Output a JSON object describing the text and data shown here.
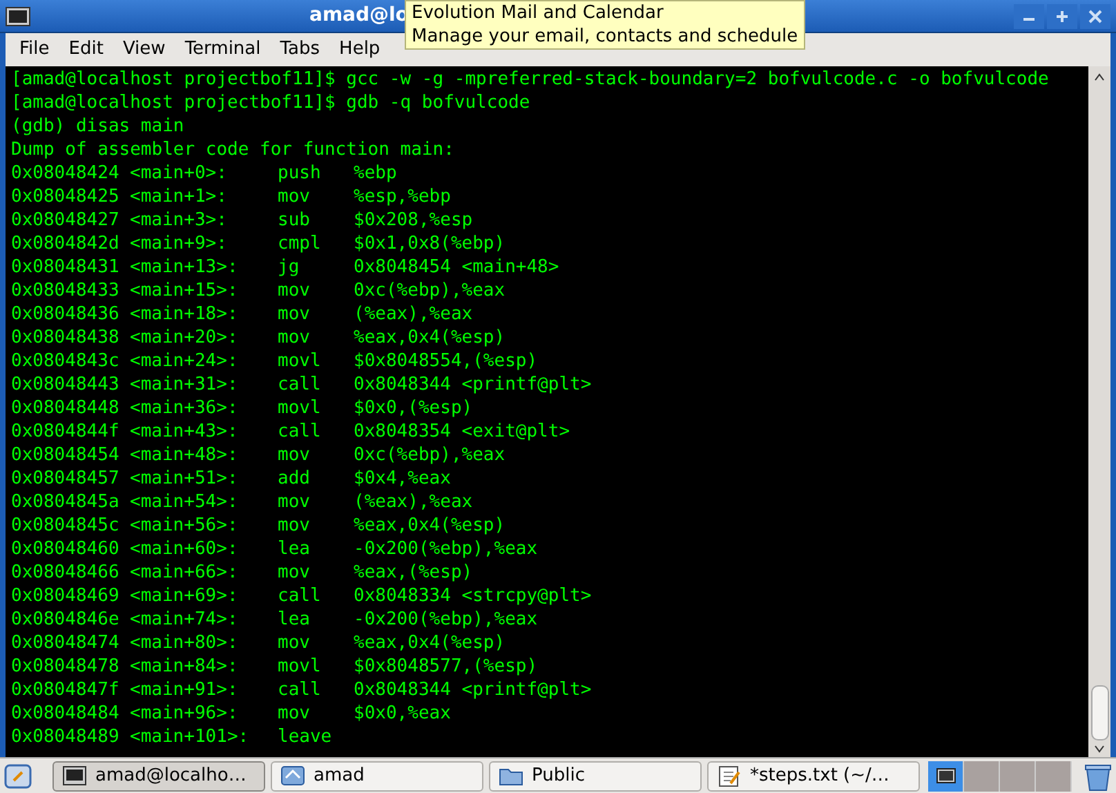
{
  "window": {
    "title": "amad@lo"
  },
  "tooltip": {
    "lines": [
      "Evolution Mail and Calendar",
      "Manage your email, contacts and schedule"
    ]
  },
  "menu": [
    "File",
    "Edit",
    "View",
    "Terminal",
    "Tabs",
    "Help"
  ],
  "terminal": [
    {
      "kind": "text",
      "text": "[amad@localhost projectbof11]$ gcc -w -g -mpreferred-stack-boundary=2 bofvulcode.c -o bofvulcode"
    },
    {
      "kind": "text",
      "text": "[amad@localhost projectbof11]$ gdb -q bofvulcode"
    },
    {
      "kind": "text",
      "text": "(gdb) disas main"
    },
    {
      "kind": "text",
      "text": "Dump of assembler code for function main:"
    },
    {
      "kind": "asm",
      "address": "0x08048424",
      "offset": "<main+0>:",
      "op": "push",
      "args": "%ebp"
    },
    {
      "kind": "asm",
      "address": "0x08048425",
      "offset": "<main+1>:",
      "op": "mov",
      "args": "%esp,%ebp"
    },
    {
      "kind": "asm",
      "address": "0x08048427",
      "offset": "<main+3>:",
      "op": "sub",
      "args": "$0x208,%esp"
    },
    {
      "kind": "asm",
      "address": "0x0804842d",
      "offset": "<main+9>:",
      "op": "cmpl",
      "args": "$0x1,0x8(%ebp)"
    },
    {
      "kind": "asm",
      "address": "0x08048431",
      "offset": "<main+13>:",
      "op": "jg",
      "args": "0x8048454 <main+48>"
    },
    {
      "kind": "asm",
      "address": "0x08048433",
      "offset": "<main+15>:",
      "op": "mov",
      "args": "0xc(%ebp),%eax"
    },
    {
      "kind": "asm",
      "address": "0x08048436",
      "offset": "<main+18>:",
      "op": "mov",
      "args": "(%eax),%eax"
    },
    {
      "kind": "asm",
      "address": "0x08048438",
      "offset": "<main+20>:",
      "op": "mov",
      "args": "%eax,0x4(%esp)"
    },
    {
      "kind": "asm",
      "address": "0x0804843c",
      "offset": "<main+24>:",
      "op": "movl",
      "args": "$0x8048554,(%esp)"
    },
    {
      "kind": "asm",
      "address": "0x08048443",
      "offset": "<main+31>:",
      "op": "call",
      "args": "0x8048344 <printf@plt>"
    },
    {
      "kind": "asm",
      "address": "0x08048448",
      "offset": "<main+36>:",
      "op": "movl",
      "args": "$0x0,(%esp)"
    },
    {
      "kind": "asm",
      "address": "0x0804844f",
      "offset": "<main+43>:",
      "op": "call",
      "args": "0x8048354 <exit@plt>"
    },
    {
      "kind": "asm",
      "address": "0x08048454",
      "offset": "<main+48>:",
      "op": "mov",
      "args": "0xc(%ebp),%eax"
    },
    {
      "kind": "asm",
      "address": "0x08048457",
      "offset": "<main+51>:",
      "op": "add",
      "args": "$0x4,%eax"
    },
    {
      "kind": "asm",
      "address": "0x0804845a",
      "offset": "<main+54>:",
      "op": "mov",
      "args": "(%eax),%eax"
    },
    {
      "kind": "asm",
      "address": "0x0804845c",
      "offset": "<main+56>:",
      "op": "mov",
      "args": "%eax,0x4(%esp)"
    },
    {
      "kind": "asm",
      "address": "0x08048460",
      "offset": "<main+60>:",
      "op": "lea",
      "args": "-0x200(%ebp),%eax"
    },
    {
      "kind": "asm",
      "address": "0x08048466",
      "offset": "<main+66>:",
      "op": "mov",
      "args": "%eax,(%esp)"
    },
    {
      "kind": "asm",
      "address": "0x08048469",
      "offset": "<main+69>:",
      "op": "call",
      "args": "0x8048334 <strcpy@plt>"
    },
    {
      "kind": "asm",
      "address": "0x0804846e",
      "offset": "<main+74>:",
      "op": "lea",
      "args": "-0x200(%ebp),%eax"
    },
    {
      "kind": "asm",
      "address": "0x08048474",
      "offset": "<main+80>:",
      "op": "mov",
      "args": "%eax,0x4(%esp)"
    },
    {
      "kind": "asm",
      "address": "0x08048478",
      "offset": "<main+84>:",
      "op": "movl",
      "args": "$0x8048577,(%esp)"
    },
    {
      "kind": "asm",
      "address": "0x0804847f",
      "offset": "<main+91>:",
      "op": "call",
      "args": "0x8048344 <printf@plt>"
    },
    {
      "kind": "asm",
      "address": "0x08048484",
      "offset": "<main+96>:",
      "op": "mov",
      "args": "$0x0,%eax"
    },
    {
      "kind": "asm",
      "address": "0x08048489",
      "offset": "<main+101>:",
      "op": "leave"
    }
  ],
  "taskbar": {
    "tasks": [
      {
        "kind": "terminal",
        "label": "amad@localho…",
        "selected": true
      },
      {
        "kind": "home",
        "label": "amad",
        "selected": false
      },
      {
        "kind": "folder",
        "label": "Public",
        "selected": false
      },
      {
        "kind": "editor",
        "label": "*steps.txt (~/…",
        "selected": false
      }
    ],
    "workspaces": [
      {
        "selected": true
      },
      {
        "selected": false
      },
      {
        "selected": false
      },
      {
        "selected": false
      }
    ]
  }
}
